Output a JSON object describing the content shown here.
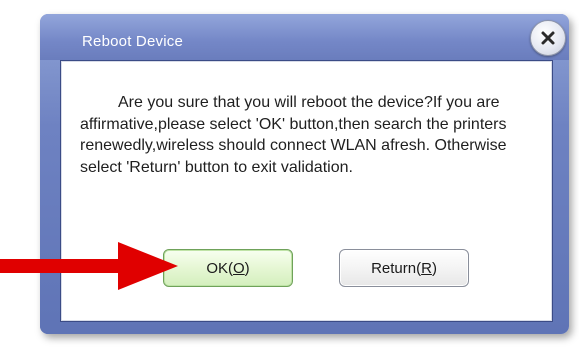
{
  "dialog": {
    "title": "Reboot Device",
    "message": "Are you sure that you will reboot the device?If you are affirmative,please select 'OK' button,then search the printers renewedly,wireless should connect WLAN afresh. Otherwise select 'Return' button to exit validation.",
    "close_icon": "close-x-icon"
  },
  "buttons": {
    "ok_label_prefix": "OK(",
    "ok_mnemonic": "O",
    "ok_label_suffix": ")",
    "return_label_prefix": "Return(",
    "return_mnemonic": "R",
    "return_label_suffix": ")"
  },
  "annotation": {
    "arrow_color": "#e00000",
    "arrow_icon": "right-arrow-icon"
  },
  "colors": {
    "title_bar": "#7487c7",
    "ok_button_bg": "#e6f7d4",
    "panel_border": "#3b4b86"
  }
}
